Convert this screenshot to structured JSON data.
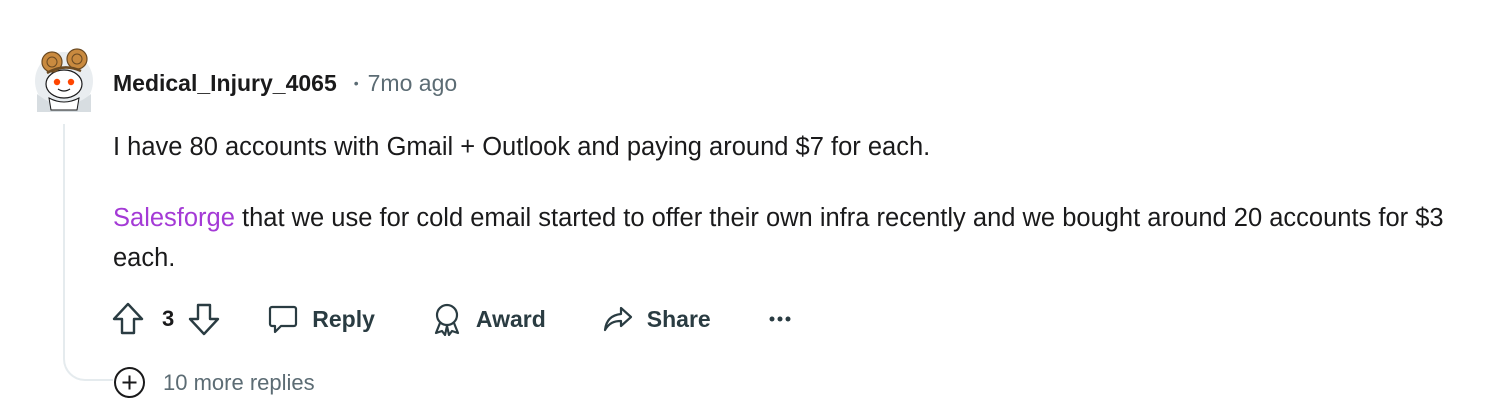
{
  "comment": {
    "author": "Medical_Injury_4065",
    "separator": "•",
    "timestamp": "7mo ago",
    "paragraph1": "I have 80 accounts with Gmail + Outlook and paying around $7 for each.",
    "link_text": "Salesforge",
    "paragraph2_rest": " that we use for cold email started to offer their own infra recently and we bought around 20 accounts for $3 each.",
    "link_color": "#a43ad6"
  },
  "actions": {
    "vote_count": "3",
    "reply_label": "Reply",
    "award_label": "Award",
    "share_label": "Share",
    "more_label": "···"
  },
  "more_replies": {
    "label": "10 more replies"
  },
  "icons": [
    "upvote-icon",
    "downvote-icon",
    "comment-bubble-icon",
    "award-icon",
    "share-arrow-icon",
    "more-dots-icon",
    "plus-circle-icon"
  ]
}
